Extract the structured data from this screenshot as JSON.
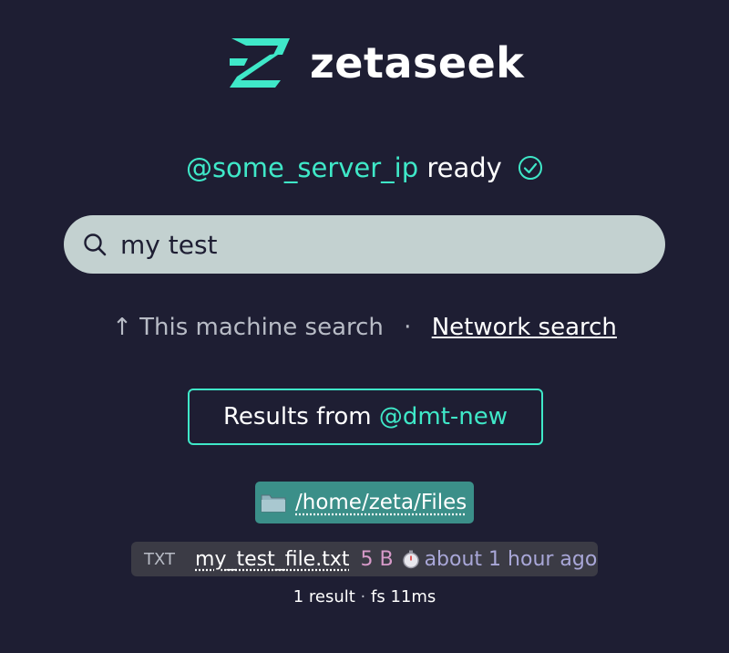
{
  "app": {
    "name": "zetaseek"
  },
  "status": {
    "server": "@some_server_ip",
    "state": "ready",
    "icon": "check-circle-icon"
  },
  "search": {
    "value": "my test",
    "icon": "search-icon"
  },
  "modes": {
    "local": "↑ This machine search",
    "separator": "·",
    "network": "Network search"
  },
  "results_from": {
    "label": "Results from",
    "node": "@dmt-new"
  },
  "results": {
    "folder": {
      "icon": "folder-icon",
      "path": "/home/zeta/Files"
    },
    "files": [
      {
        "type": "TXT",
        "name": "my_test_file.txt",
        "size": "5 B",
        "time_icon": "stopwatch-icon",
        "modified": "about 1 hour ago"
      }
    ],
    "count_text": "1 result",
    "separator": "·",
    "timing": "fs 11ms"
  },
  "colors": {
    "background": "#1e1e33",
    "accent": "#3fe8c8",
    "search_bg": "#c3d1d0",
    "folder_bg": "#3b8f89",
    "row_bg": "#3b3b45",
    "size": "#d79ac9",
    "time": "#a9a7d8"
  }
}
